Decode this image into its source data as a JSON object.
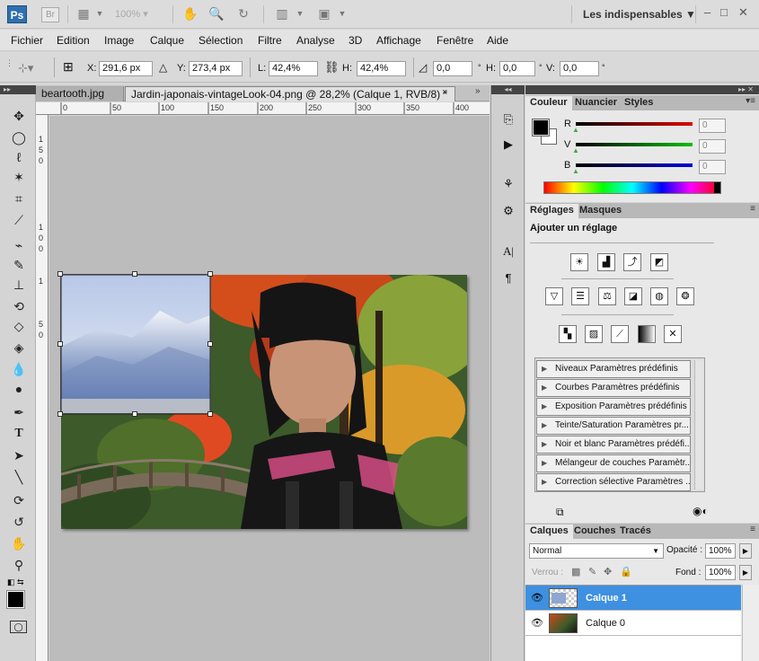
{
  "app": {
    "logo": "Ps",
    "bridge_logo": "Br",
    "zoom": "100%",
    "workspace": "Les indispensables",
    "window_controls": [
      "–",
      "□",
      "✕"
    ]
  },
  "menu": [
    "Fichier",
    "Edition",
    "Image",
    "Calque",
    "Sélection",
    "Filtre",
    "Analyse",
    "3D",
    "Affichage",
    "Fenêtre",
    "Aide"
  ],
  "options": {
    "x_label": "X:",
    "x_value": "291,6 px",
    "y_label": "Y:",
    "y_value": "273,4 px",
    "w_label": "L:",
    "w_value": "42,4%",
    "h_label": "H:",
    "h_value": "42,4%",
    "rot_value": "0,0",
    "hskew_label": "H:",
    "hskew_value": "0,0",
    "vskew_label": "V:",
    "vskew_value": "0,0"
  },
  "tabs": [
    {
      "label": "beartooth.jpg",
      "active": false
    },
    {
      "label": "Jardin-japonais-vintageLook-04.png @ 28,2% (Calque 1, RVB/8) *",
      "active": true
    }
  ],
  "ruler_h": [
    "0",
    "50",
    "100",
    "150",
    "200",
    "250",
    "300",
    "350",
    "400"
  ],
  "ruler_v": [
    "1",
    "5",
    "0",
    "1",
    "0",
    "0",
    "1",
    "5",
    "0"
  ],
  "color_panel": {
    "tabs": [
      "Couleur",
      "Nuancier",
      "Styles"
    ],
    "channels": [
      {
        "label": "R",
        "value": "0",
        "color": "#e00000"
      },
      {
        "label": "V",
        "value": "0",
        "color": "#00c000"
      },
      {
        "label": "B",
        "value": "0",
        "color": "#0000e0"
      }
    ]
  },
  "adjust_panel": {
    "tabs": [
      "Réglages",
      "Masques"
    ],
    "title": "Ajouter un réglage",
    "presets": [
      "Niveaux Paramètres prédéfinis",
      "Courbes Paramètres prédéfinis",
      "Exposition Paramètres prédéfinis",
      "Teinte/Saturation Paramètres pr...",
      "Noir et blanc Paramètres prédéfi...",
      "Mélangeur de couches Paramètr...",
      "Correction sélective Paramètres ..."
    ]
  },
  "layers_panel": {
    "tabs": [
      "Calques",
      "Couches",
      "Tracés"
    ],
    "blend_mode": "Normal",
    "opacity_label": "Opacité :",
    "opacity_value": "100%",
    "lock_label": "Verrou :",
    "fill_label": "Fond :",
    "fill_value": "100%",
    "layers": [
      {
        "name": "Calque 1",
        "selected": true
      },
      {
        "name": "Calque 0",
        "selected": false
      }
    ]
  }
}
